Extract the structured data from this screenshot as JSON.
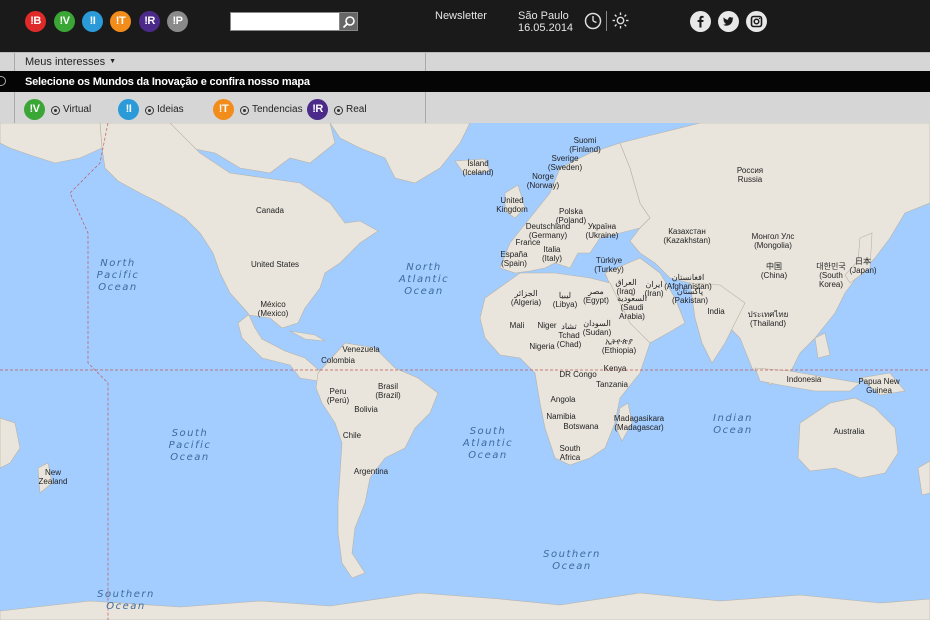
{
  "header": {
    "brands": [
      {
        "label": "!B",
        "color": "#e02a2a"
      },
      {
        "label": "!V",
        "color": "#3aa635"
      },
      {
        "label": "!I",
        "color": "#2a9ad8"
      },
      {
        "label": "!T",
        "color": "#f28d1c"
      },
      {
        "label": "!R",
        "color": "#4b2a8a"
      },
      {
        "label": "!P",
        "color": "#8a8a8a"
      }
    ],
    "search_placeholder": "",
    "newsletter": "Newsletter",
    "city": "São Paulo",
    "date": "16.05.2014"
  },
  "interests": {
    "label": "Meus interesses",
    "banner": "Selecione os Mundos da Inovação e confira nosso mapa",
    "worlds": [
      {
        "label": "!V",
        "name": "Virtual",
        "color": "#3aa635"
      },
      {
        "label": "!I",
        "name": "Ideias",
        "color": "#2a9ad8"
      },
      {
        "label": "!T",
        "name": "Tendencias",
        "color": "#f28d1c"
      },
      {
        "label": "!R",
        "name": "Real",
        "color": "#4b2a8a"
      }
    ]
  },
  "map": {
    "countries": [
      [
        "Ísland",
        "(Iceland)"
      ],
      [
        "Suomi",
        "(Finland)"
      ],
      [
        "Sverige",
        "(Sweden)"
      ],
      [
        "Norge",
        "(Norway)"
      ],
      [
        "Россия",
        "Russia"
      ],
      [
        "United",
        "Kingdom"
      ],
      [
        "Polska",
        "(Poland)"
      ],
      [
        "Deutschland",
        "(Germany)"
      ],
      [
        "Україна",
        "(Ukraine)"
      ],
      [
        "France",
        ""
      ],
      [
        "Italia",
        "(Italy)"
      ],
      [
        "España",
        "(Spain)"
      ],
      [
        "Türkiye",
        "(Turkey)"
      ],
      [
        "Казахстан",
        "(Kazakhstan)"
      ],
      [
        "Монгол Улс",
        "(Mongolia)"
      ],
      [
        "日本",
        "(Japan)"
      ],
      [
        "대한민국",
        "(South",
        "Korea)"
      ],
      [
        "中国",
        "(China)"
      ],
      [
        "Canada",
        ""
      ],
      [
        "United States",
        ""
      ],
      [
        "México",
        "(Mexico)"
      ],
      [
        "الجزائر",
        "(Algeria)"
      ],
      [
        "ليبيا",
        "(Libya)"
      ],
      [
        "مصر",
        "(Egypt)"
      ],
      [
        "العراق",
        "(Iraq)"
      ],
      [
        "ایران",
        "(Iran)"
      ],
      [
        "افغانستان",
        "(Afghanistan)"
      ],
      [
        "پاکستان",
        "(Pakistan)"
      ],
      [
        "السعودية",
        "(Saudi",
        "Arabia)"
      ],
      [
        "India",
        ""
      ],
      [
        "ประเทศไทย",
        "(Thailand)"
      ],
      [
        "Mali",
        ""
      ],
      [
        "Niger",
        ""
      ],
      [
        "تشاد",
        "Tchad",
        "(Chad)"
      ],
      [
        "السودان",
        "(Sudan)"
      ],
      [
        "ኢትዮጵያ",
        "(Ethiopia)"
      ],
      [
        "Nigeria",
        ""
      ],
      [
        "Venezuela",
        ""
      ],
      [
        "Colombia",
        ""
      ],
      [
        "DR Congo",
        ""
      ],
      [
        "Kenya",
        ""
      ],
      [
        "Tanzania",
        ""
      ],
      [
        "Indonesia",
        ""
      ],
      [
        "Papua New",
        "Guinea"
      ],
      [
        "Peru",
        "(Perú)"
      ],
      [
        "Brasil",
        "(Brazil)"
      ],
      [
        "Bolivia",
        ""
      ],
      [
        "Angola",
        ""
      ],
      [
        "Namibia",
        ""
      ],
      [
        "Botswana",
        ""
      ],
      [
        "Madagasikara",
        "(Madagascar)"
      ],
      [
        "Chile",
        ""
      ],
      [
        "Argentina",
        ""
      ],
      [
        "South",
        "Africa"
      ],
      [
        "Australia",
        ""
      ],
      [
        "New",
        "Zealand"
      ]
    ],
    "oceans": [
      [
        "North",
        "Pacific",
        "Ocean"
      ],
      [
        "North",
        "Atlantic",
        "Ocean"
      ],
      [
        "South",
        "Pacific",
        "Ocean"
      ],
      [
        "South",
        "Atlantic",
        "Ocean"
      ],
      [
        "Indian",
        "Ocean"
      ],
      [
        "Southern",
        "Ocean"
      ],
      [
        "Southern",
        "Ocean"
      ]
    ]
  }
}
